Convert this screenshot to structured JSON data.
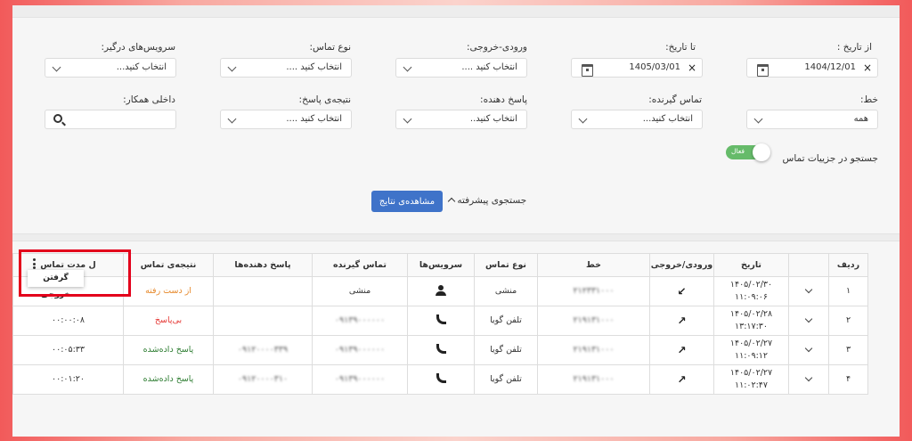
{
  "filters": {
    "from_date": {
      "label": "از تاریخ :",
      "value": "1404/12/01"
    },
    "to_date": {
      "label": "تا تاریخ:",
      "value": "1405/03/01"
    },
    "direction": {
      "label": "ورودی-خروجی:",
      "value": "انتخاب کنید ...."
    },
    "call_type": {
      "label": "نوع تماس:",
      "value": "انتخاب کنید ...."
    },
    "other_services": {
      "label": "سرویس‌های درگیر:",
      "value": "انتخاب کنید..."
    },
    "line": {
      "label": "خط:",
      "value": "همه"
    },
    "callee": {
      "label": "تماس گیرنده:",
      "value": "انتخاب کنید..."
    },
    "responder": {
      "label": "پاسخ دهنده:",
      "value": "انتخاب کنید.."
    },
    "result": {
      "label": "نتیجه‌ی پاسخ:",
      "value": "انتخاب کنید ...."
    },
    "extension": {
      "label": "داخلی همکار:",
      "value": ""
    },
    "detail_search": {
      "label": "جستجو در جزییات تماس",
      "state": "فعال",
      "enabled": true
    },
    "advanced_search": "جستجوی پیشرفته",
    "show_results": "مشاهده‌ی نتایج"
  },
  "table": {
    "headers": [
      "ردیف",
      "",
      "تاریخ",
      "ورودی/خروجی",
      "خط",
      "نوع تماس",
      "سرویس‌ها",
      "تماس گیرنده",
      "پاسخ دهنده‌ها",
      "نتیجه‌ی تماس",
      "ل مدت تماس"
    ],
    "rows": [
      {
        "idx": "۱",
        "date": "۱۴۰۵/۰۲/۳۰",
        "time": "۱۱:۰۹:۰۶",
        "dir": "↙",
        "line": "۲۱۲۳۳۱۰۰۰",
        "type": "منشی",
        "service": "person",
        "caller": "منشی",
        "responders": "",
        "result": "از دست رفته",
        "result_color": "orange",
        "duration": ""
      },
      {
        "idx": "۲",
        "date": "۱۴۰۵/۰۲/۲۸",
        "time": "۱۳:۱۷:۳۰",
        "dir": "↗",
        "line": "۲۱۹۱۳۱۰۰۰",
        "type": "تلفن گویا",
        "service": "phone",
        "caller": "۰۹۱۳۹۰۰۰۰۰۰",
        "responders": "",
        "result": "بی‌پاسخ",
        "result_color": "red",
        "duration": "۰۰:۰۰:۰۸"
      },
      {
        "idx": "۳",
        "date": "۱۴۰۵/۰۲/۲۷",
        "time": "۱۱:۰۹:۱۲",
        "dir": "↗",
        "line": "۲۱۹۱۳۱۰۰۰",
        "type": "تلفن گویا",
        "service": "phone",
        "caller": "۰۹۱۳۹۰۰۰۰۰۰",
        "responders": "۰۹۱۲۰۰۰۰۳۳۹",
        "result": "پاسخ داده‌شده",
        "result_color": "green",
        "duration": "۰۰:۰۵:۳۳"
      },
      {
        "idx": "۴",
        "date": "۱۴۰۵/۰۲/۲۷",
        "time": "۱۱:۰۲:۴۷",
        "dir": "↗",
        "line": "۲۱۹۱۳۱۰۰۰",
        "type": "تلفن گویا",
        "service": "phone",
        "caller": "۰۹۱۳۹۰۰۰۰۰۰",
        "responders": "۰۹۱۲۰۰۰۰۳۱۰",
        "result": "پاسخ داده‌شده",
        "result_color": "green",
        "duration": "۰۰:۰۱:۲۰"
      }
    ],
    "export_menu": "گرفتن خروجی"
  }
}
